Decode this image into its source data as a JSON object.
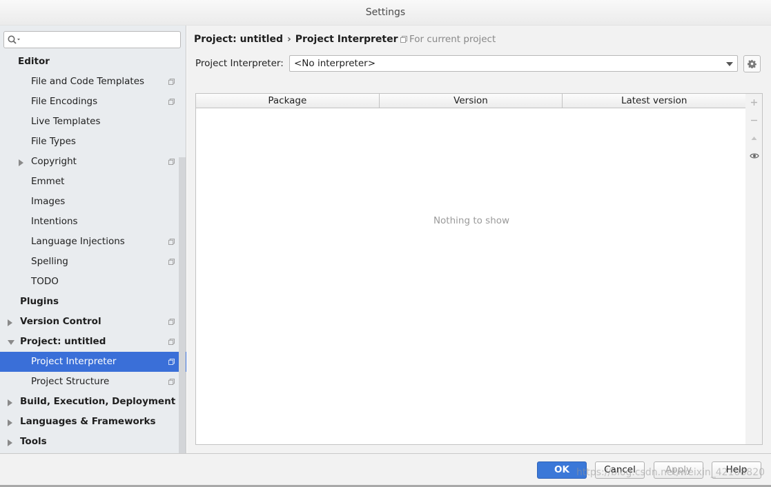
{
  "window": {
    "title": "Settings"
  },
  "search": {
    "placeholder": "",
    "value": ""
  },
  "sidebar": {
    "items": [
      {
        "label": "Editor",
        "level": 0,
        "bold": true
      },
      {
        "label": "File and Code Templates",
        "level": 1,
        "copy": true
      },
      {
        "label": "File Encodings",
        "level": 1,
        "copy": true
      },
      {
        "label": "Live Templates",
        "level": 1
      },
      {
        "label": "File Types",
        "level": 1
      },
      {
        "label": "Copyright",
        "level": 1,
        "arrow": "right",
        "copy": true
      },
      {
        "label": "Emmet",
        "level": 1
      },
      {
        "label": "Images",
        "level": 1
      },
      {
        "label": "Intentions",
        "level": 1
      },
      {
        "label": "Language Injections",
        "level": 1,
        "copy": true
      },
      {
        "label": "Spelling",
        "level": 1,
        "copy": true
      },
      {
        "label": "TODO",
        "level": 1
      },
      {
        "label": "Plugins",
        "level": 0,
        "bold": true
      },
      {
        "label": "Version Control",
        "level": 0,
        "bold": true,
        "arrow": "right",
        "copy": true
      },
      {
        "label": "Project: untitled",
        "level": 0,
        "bold": true,
        "arrow": "down",
        "copy": true
      },
      {
        "label": "Project Interpreter",
        "level": 1,
        "copy": true,
        "selected": true
      },
      {
        "label": "Project Structure",
        "level": 1,
        "copy": true
      },
      {
        "label": "Build, Execution, Deployment",
        "level": 0,
        "bold": true,
        "arrow": "right"
      },
      {
        "label": "Languages & Frameworks",
        "level": 0,
        "bold": true,
        "arrow": "right"
      },
      {
        "label": "Tools",
        "level": 0,
        "bold": true,
        "arrow": "right"
      }
    ]
  },
  "breadcrumb": {
    "parent": "Project: untitled",
    "separator": "›",
    "current": "Project Interpreter"
  },
  "scope": {
    "label": "For current project"
  },
  "interpreter": {
    "label": "Project Interpreter:",
    "value": "<No interpreter>"
  },
  "packages_table": {
    "columns": [
      "Package",
      "Version",
      "Latest version"
    ],
    "rows": [],
    "empty_text": "Nothing to show"
  },
  "table_tools": [
    "plus-icon",
    "minus-icon",
    "upgrade-icon",
    "eye-icon"
  ],
  "buttons": {
    "ok": "OK",
    "cancel": "Cancel",
    "apply": "Apply",
    "help": "Help"
  },
  "watermark": "https://blog.csdn.net/weixin_42108820",
  "colors": {
    "selection": "#3a6fd8",
    "primary_button": "#3b78d8",
    "sidebar_bg": "#e9ecef"
  }
}
